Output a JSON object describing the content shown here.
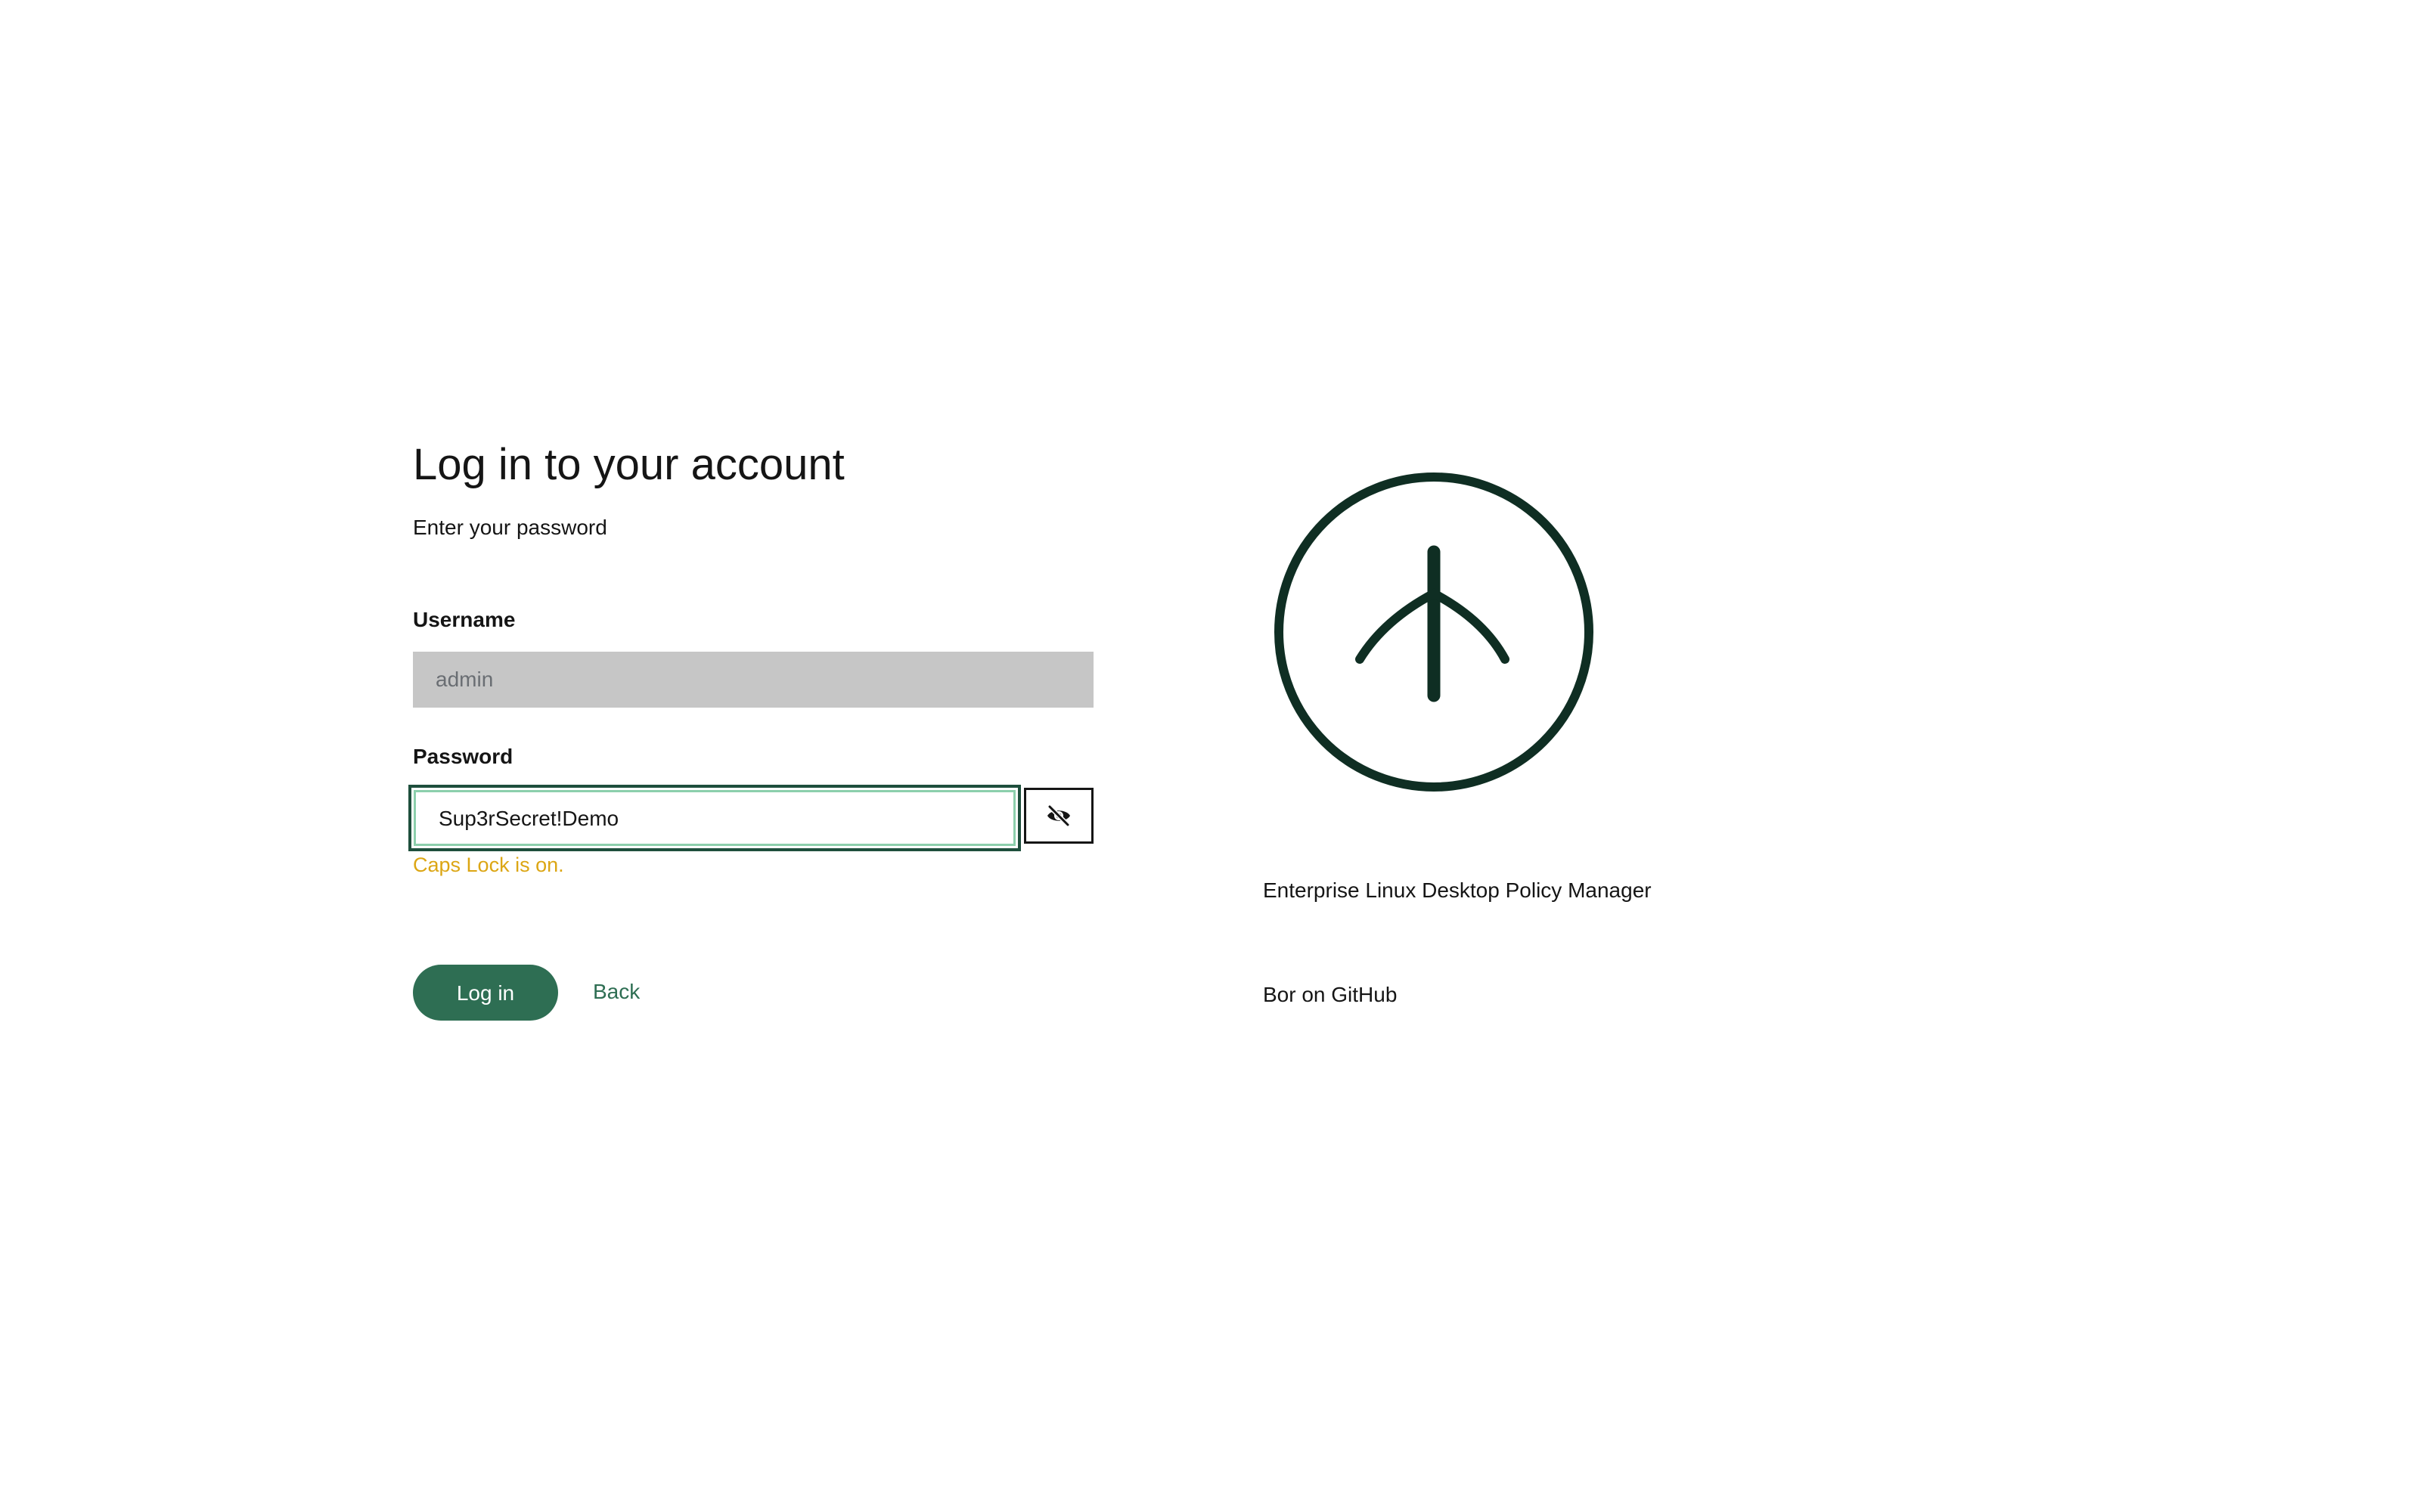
{
  "login": {
    "title": "Log in to your account",
    "subtitle": "Enter your password",
    "username_label": "Username",
    "username_value": "admin",
    "password_label": "Password",
    "password_value": "Sup3rSecret!Demo",
    "password_toggle_icon": "eye-slash-icon",
    "caps_lock_warning": "Caps Lock is on.",
    "login_button": "Log in",
    "back_link": "Back"
  },
  "brand": {
    "logo_icon": "bor-logo-icon",
    "product_name": "Enterprise Linux Desktop Policy Manager",
    "github_link": "Bor on GitHub"
  },
  "colors": {
    "accent": "#2e6e53",
    "logo": "#0f2e23",
    "warning": "#dca614",
    "disabled_field": "#c6c6c6",
    "focus_outer": "#1e4f3c",
    "focus_inner": "#8ccfac"
  }
}
